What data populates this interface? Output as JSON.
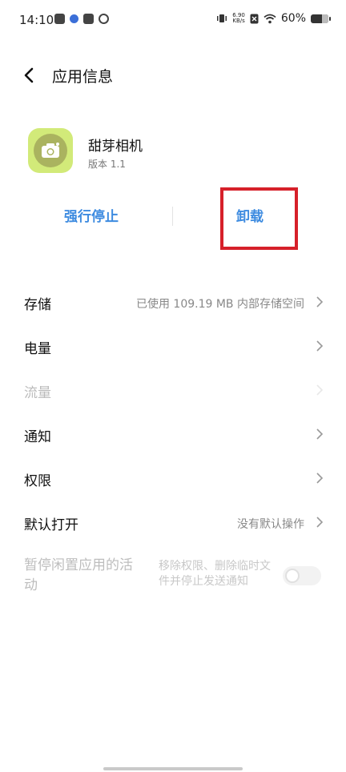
{
  "status_bar": {
    "time": "14:10",
    "net_speed_value": "6.90",
    "net_speed_unit": "KB/s",
    "battery_percent": "60%"
  },
  "header": {
    "title": "应用信息"
  },
  "app": {
    "name": "甜芽相机",
    "version": "版本 1.1",
    "icon": "camera-icon"
  },
  "actions": {
    "force_stop": "强行停止",
    "uninstall": "卸载"
  },
  "rows": [
    {
      "label": "存储",
      "value": "已使用 109.19 MB 内部存储空间",
      "enabled": true
    },
    {
      "label": "电量",
      "value": "",
      "enabled": true
    },
    {
      "label": "流量",
      "value": "",
      "enabled": false
    },
    {
      "label": "通知",
      "value": "",
      "enabled": true
    },
    {
      "label": "权限",
      "value": "",
      "enabled": true
    },
    {
      "label": "默认打开",
      "value": "没有默认操作",
      "enabled": true
    }
  ],
  "pause_activity": {
    "label": "暂停闲置应用的活动",
    "description": "移除权限、删除临时文件并停止发送通知",
    "enabled": false,
    "checked": false
  },
  "colors": {
    "accent": "#3d8be0",
    "highlight": "#d6202a",
    "app_icon_bg": "#d2ea79"
  }
}
